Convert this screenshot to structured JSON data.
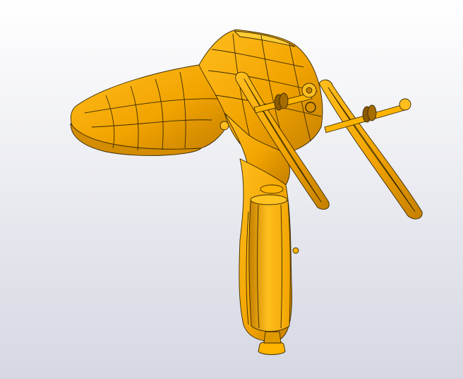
{
  "scene": {
    "background_top": "#ffffff",
    "background_bottom": "#d5d7e2",
    "model_fill": "#f2a400",
    "model_fill_light": "#ffbe1e",
    "model_fill_dark": "#c47f00",
    "edge_color": "#3a2a00"
  }
}
